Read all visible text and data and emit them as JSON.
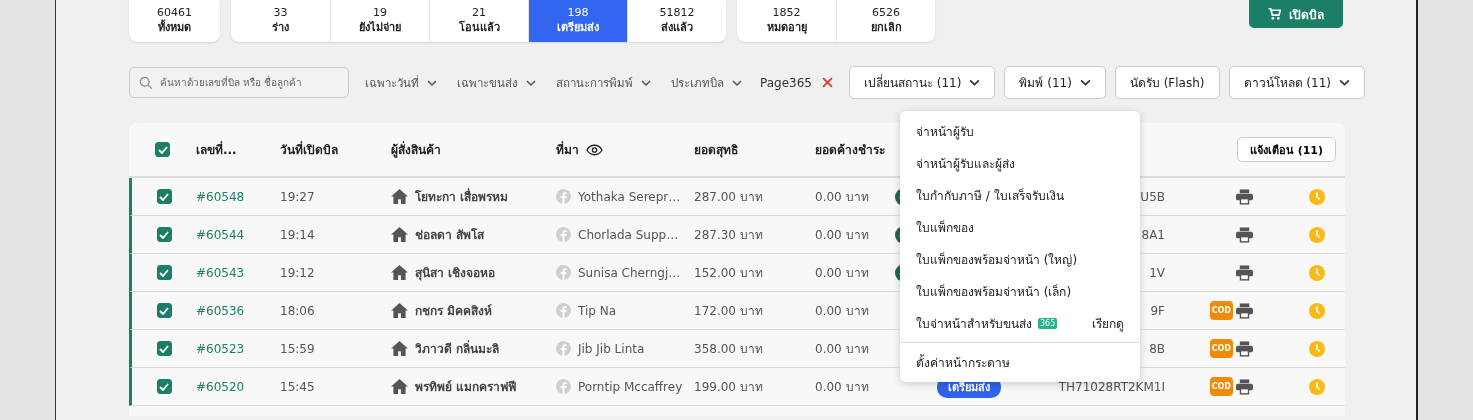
{
  "status_tabs": [
    [
      {
        "count": "60461",
        "label": "ทั้งหมด",
        "selected": false
      }
    ],
    [
      {
        "count": "33",
        "label": "ร่าง",
        "selected": false
      },
      {
        "count": "19",
        "label": "ยังไม่จ่าย",
        "selected": false
      },
      {
        "count": "21",
        "label": "โอนแล้ว",
        "selected": false
      },
      {
        "count": "198",
        "label": "เตรียมส่ง",
        "selected": true
      },
      {
        "count": "51812",
        "label": "ส่งแล้ว",
        "selected": false
      }
    ],
    [
      {
        "count": "1852",
        "label": "หมดอายุ",
        "selected": false
      },
      {
        "count": "6526",
        "label": "ยกเลิก",
        "selected": false
      }
    ]
  ],
  "open_bill_button": "เปิดบิล",
  "search": {
    "placeholder": "ค้นหาด้วยเลขที่บิล หรือ ชื่อลูกค้า"
  },
  "filters": [
    "เฉพาะวันที่",
    "เฉพาะขนส่ง",
    "สถานะการพิมพ์",
    "ประเภทบิล"
  ],
  "filter_chip": "Page365",
  "actions": [
    {
      "label": "เปลี่ยนสถานะ (11)",
      "dropdown": true
    },
    {
      "label": "พิมพ์ (11)",
      "dropdown": true
    },
    {
      "label": "นัดรับ (Flash)",
      "dropdown": false
    },
    {
      "label": "ดาวน์โหลด (11)",
      "dropdown": true
    }
  ],
  "table": {
    "all_checked": true,
    "columns": [
      "เลขที่...",
      "วันที่เปิดบิล",
      "ผู้สั่งสินค้า",
      "ที่มา",
      "ยอดสุทธิ",
      "ยอดค้างชำระ"
    ],
    "alert_button": "แจ้งเตือน (11)",
    "rows": [
      {
        "checked": true,
        "id": "#60548",
        "time": "19:27",
        "customer": "โยทะกา เสื่อพรหม",
        "source": "Yothaka Serepr…",
        "net": "287.00 บาท",
        "due": "0.00 บาท",
        "status": {
          "kind": "paid"
        },
        "tracking": "U5B"
      },
      {
        "checked": true,
        "id": "#60544",
        "time": "19:14",
        "customer": "ช่อลดา สัพโส",
        "source": "Chorlada Supp…",
        "net": "287.30 บาท",
        "due": "0.00 บาท",
        "status": {
          "kind": "paid"
        },
        "tracking": "8A1"
      },
      {
        "checked": true,
        "id": "#60543",
        "time": "19:12",
        "customer": "สุนิสา เชิงจอหอ",
        "source": "Sunisa Cherngj…",
        "net": "152.00 บาท",
        "due": "0.00 บาท",
        "status": {
          "kind": "paid"
        },
        "tracking": "1V"
      },
      {
        "checked": true,
        "id": "#60536",
        "time": "18:06",
        "customer": "กชกร มิคคสิงห์",
        "source": "Tip Na",
        "net": "172.00 บาท",
        "due": "0.00 บาท",
        "tracking": "9F",
        "cod": "COD"
      },
      {
        "checked": true,
        "id": "#60523",
        "time": "15:59",
        "customer": "วิภาวดี กลิ่นมะลิ",
        "source": "Jib Jib Linta",
        "net": "358.00 บาท",
        "due": "0.00 บาท",
        "tracking": "8B",
        "cod": "COD"
      },
      {
        "checked": true,
        "id": "#60520",
        "time": "15:45",
        "customer": "พรทิพย์ แมกคราฟฟี",
        "source": "Porntip Mccaffrey",
        "net": "199.00 บาท",
        "due": "0.00 บาท",
        "status": {
          "kind": "badge",
          "label": "เตรียมส่ง"
        },
        "tracking": "TH71028RT2KM1I",
        "cod": "COD"
      }
    ]
  },
  "print_menu": {
    "items": [
      {
        "label": "จ่าหน้าผู้รับ"
      },
      {
        "label": "จ่าหน้าผู้รับและผู้ส่ง"
      },
      {
        "label": "ใบกำกับภาษี / ใบเสร็จรับเงิน"
      },
      {
        "label": "ใบแพ็กของ"
      },
      {
        "label": "ใบแพ็กของพร้อมจ่าหน้า (ใหญ่)"
      },
      {
        "label": "ใบแพ็กของพร้อมจ่าหน้า (เล็ก)"
      },
      {
        "label": "ใบจ่าหน้าสำหรับขนส่ง",
        "badge": "365",
        "link": "เรียกดู"
      }
    ],
    "footer_item": "ตั้งค่าหน้ากระดาษ"
  }
}
